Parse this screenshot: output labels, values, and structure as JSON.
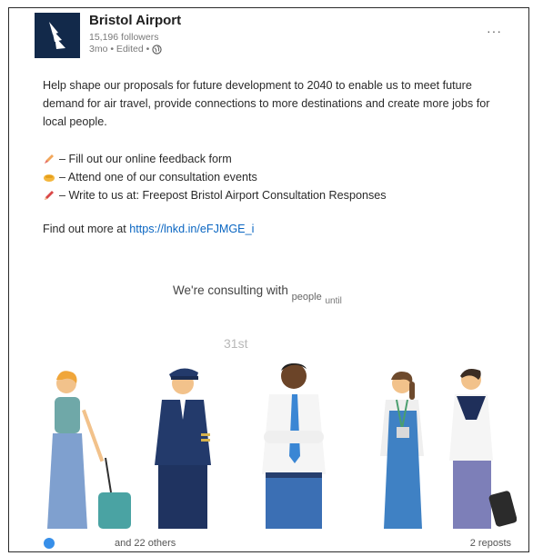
{
  "post": {
    "org_name": "Bristol Airport",
    "followers": "15,196 followers",
    "meta": "3mo • Edited •",
    "more_label": "···",
    "body": "Help shape our proposals for future development to 2040 to enable us to meet future demand for air travel, provide connections to more destinations and create more jobs for local people.",
    "bullets": [
      {
        "icon": "pencil-icon",
        "text": "– Fill out our online feedback form"
      },
      {
        "icon": "handshake-icon",
        "text": "– Attend one of our consultation events"
      },
      {
        "icon": "pen-icon",
        "text": "– Write to us at: Freepost Bristol Airport Consultation Responses"
      }
    ],
    "find_more_prefix": "Find out more at ",
    "find_more_link": "https://lnkd.in/eFJMGE_i"
  },
  "image": {
    "consult_main": "We're consulting with",
    "consult_people": "people",
    "consult_until": "until",
    "date": "31st"
  },
  "footer": {
    "reactions": "and 22 others",
    "reposts": "2 reposts"
  },
  "colors": {
    "brand": "#12294a",
    "link": "#0a66c2"
  }
}
